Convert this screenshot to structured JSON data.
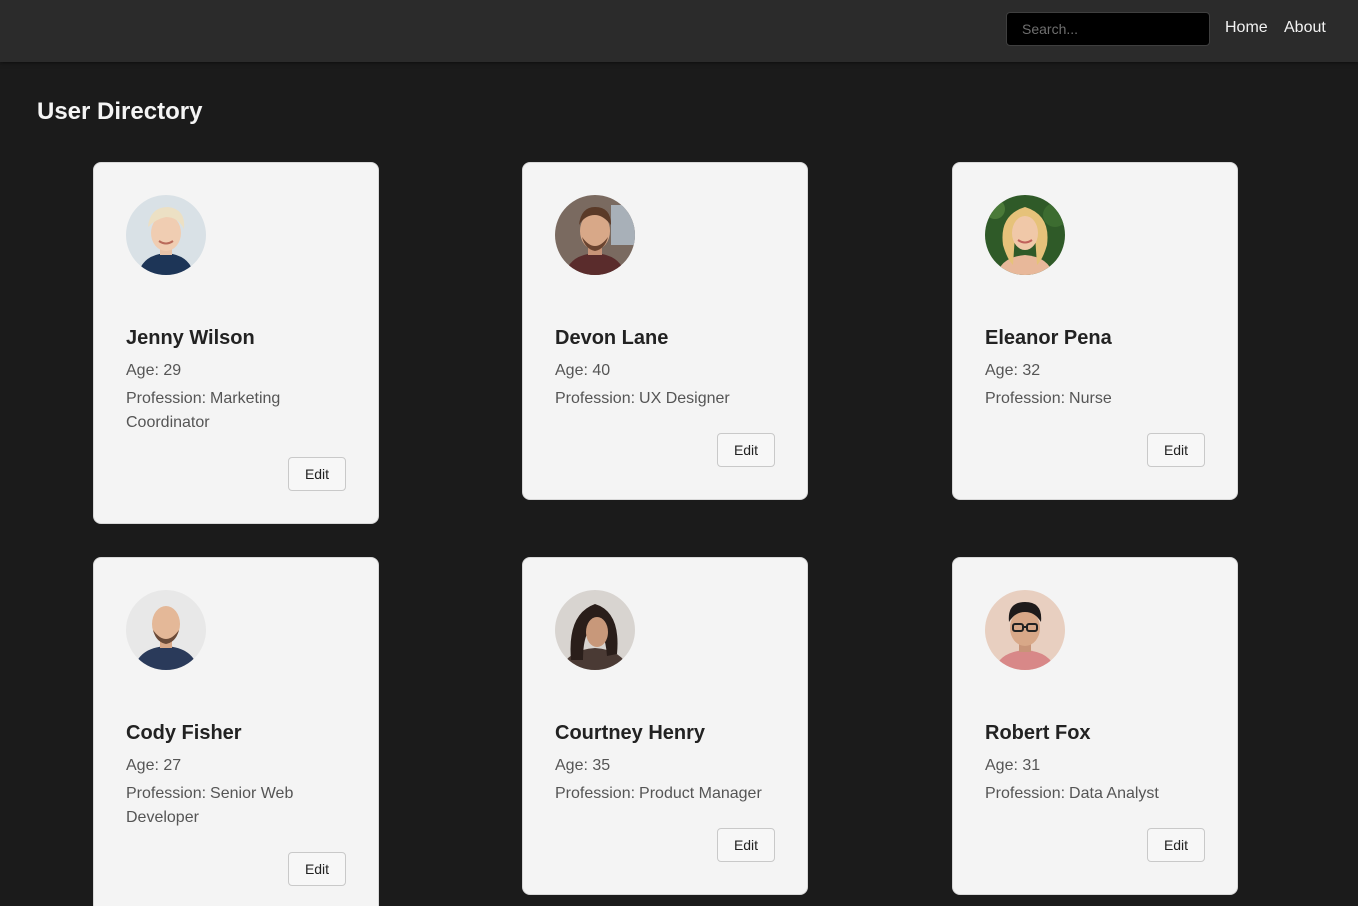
{
  "nav": {
    "search_placeholder": "Search...",
    "home_label": "Home",
    "about_label": "About"
  },
  "page": {
    "title": "User Directory"
  },
  "labels": {
    "age": "Age:",
    "profession": "Profession:",
    "edit": "Edit"
  },
  "users": [
    {
      "name": "Jenny Wilson",
      "age": "29",
      "profession": "Marketing Coordinator"
    },
    {
      "name": "Devon Lane",
      "age": "40",
      "profession": "UX Designer"
    },
    {
      "name": "Eleanor Pena",
      "age": "32",
      "profession": "Nurse"
    },
    {
      "name": "Cody Fisher",
      "age": "27",
      "profession": "Senior Web Developer"
    },
    {
      "name": "Courtney Henry",
      "age": "35",
      "profession": "Product Manager"
    },
    {
      "name": "Robert Fox",
      "age": "31",
      "profession": "Data Analyst"
    }
  ],
  "colors": {
    "page_background": "#1b1b1b",
    "navbar_background": "#2b2b2b",
    "card_background": "#f4f4f4"
  }
}
